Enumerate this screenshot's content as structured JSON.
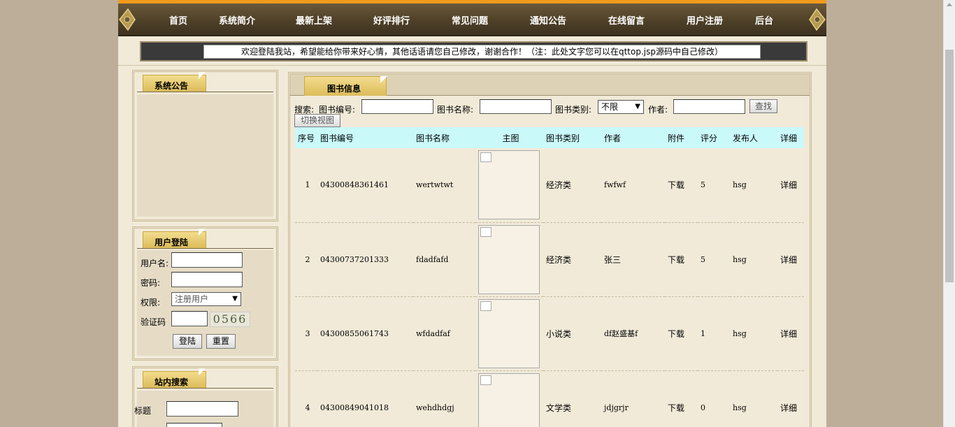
{
  "nav": {
    "items": [
      "首页",
      "系统简介",
      "最新上架",
      "好评排行",
      "常见问题",
      "通知公告",
      "在线留言",
      "用户注册",
      "后台"
    ]
  },
  "marquee": "欢迎登陆我站，希望能给你带来好心情，其他话语请您自己修改，谢谢合作！（注：此处文字您可以在qttop.jsp源码中自己修改）",
  "sidebar": {
    "notice_title": "系统公告",
    "login": {
      "title": "用户登陆",
      "username_label": "用户名:",
      "password_label": "密码:",
      "role_label": "权限:",
      "role_value": "注册用户",
      "captcha_label": "验证码",
      "captcha_value": "0566",
      "login_button": "登陆",
      "reset_button": "重置"
    },
    "search": {
      "title": "站内搜索",
      "title_label": "标题"
    }
  },
  "main": {
    "title": "图书信息",
    "search": {
      "prefix": "搜索:",
      "code_label": "图书编号:",
      "name_label": "图书名称:",
      "category_label": "图书类别:",
      "category_value": "不限",
      "author_label": "作者:",
      "search_button": "查找",
      "switch_button": "切换视图"
    },
    "columns": [
      "序号",
      "图书编号",
      "图书名称",
      "主图",
      "图书类别",
      "作者",
      "附件",
      "评分",
      "发布人",
      "详细"
    ],
    "rows": [
      {
        "no": "1",
        "code": "04300848361461",
        "name": "wertwtwt",
        "category": "经济类",
        "author": "fwfwf",
        "attachment": "下载",
        "rating": "5",
        "publisher": "hsg",
        "detail": "详细"
      },
      {
        "no": "2",
        "code": "04300737201333",
        "name": "fdadfafd",
        "category": "经济类",
        "author": "张三",
        "attachment": "下载",
        "rating": "5",
        "publisher": "hsg",
        "detail": "详细"
      },
      {
        "no": "3",
        "code": "04300855061743",
        "name": "wfdadfaf",
        "category": "小说类",
        "author": "df赵盛基f",
        "attachment": "下载",
        "rating": "1",
        "publisher": "hsg",
        "detail": "详细"
      },
      {
        "no": "4",
        "code": "04300849041018",
        "name": "wehdhdgj",
        "category": "文学类",
        "author": "jdjgrjr",
        "attachment": "下载",
        "rating": "0",
        "publisher": "hsg",
        "detail": "详细"
      }
    ]
  },
  "colors": {
    "nav_bg": "#4f4128",
    "accent_orange": "#f29a1c",
    "header_row": "#caf9fa",
    "tab_gold": "#e8c96e",
    "panel_bg": "#f1ead8"
  }
}
